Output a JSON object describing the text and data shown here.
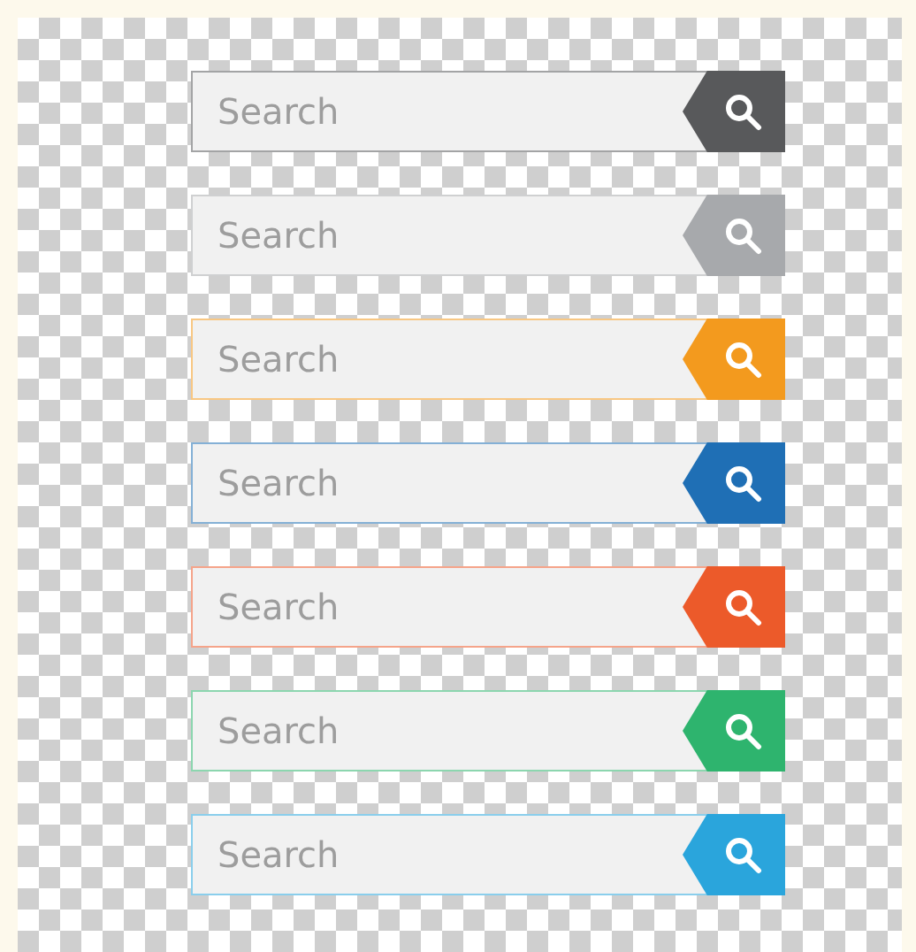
{
  "search_bars": [
    {
      "placeholder": "Search",
      "color": "#58595b"
    },
    {
      "placeholder": "Search",
      "color": "#a7a9ac"
    },
    {
      "placeholder": "Search",
      "color": "#f39a1e"
    },
    {
      "placeholder": "Search",
      "color": "#1f6fb5"
    },
    {
      "placeholder": "Search",
      "color": "#ec5a2a"
    },
    {
      "placeholder": "Search",
      "color": "#2eb46e"
    },
    {
      "placeholder": "Search",
      "color": "#2aa5dc"
    }
  ]
}
